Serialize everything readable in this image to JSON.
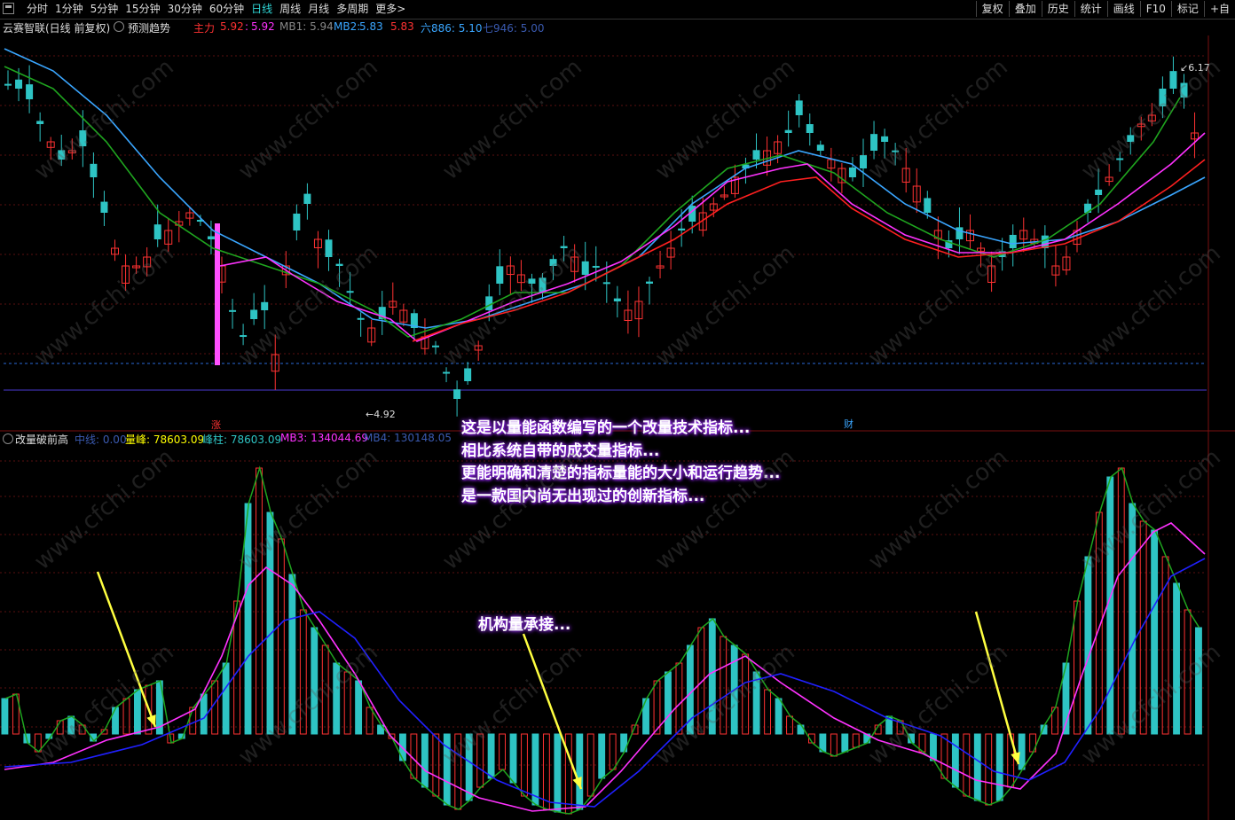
{
  "toolbar": {
    "timeframes": [
      "分时",
      "1分钟",
      "5分钟",
      "15分钟",
      "30分钟",
      "60分钟",
      "日线",
      "周线",
      "月线",
      "多周期",
      "更多>"
    ],
    "active": "日线",
    "right_buttons": [
      "复权",
      "叠加",
      "历史",
      "统计",
      "画线",
      "F10",
      "标记",
      "+自"
    ]
  },
  "main_title": {
    "stock": "云赛智联(日线 前复权)",
    "predict": "预测趋势",
    "zhuli_label": "主力",
    "zhuli_v1": "5.92",
    "zhuli_v2": "5.92",
    "mb1": "MB1: 5.94",
    "mb2_label": "MB2:",
    "mb2_v1": "5.83",
    "mb2_v2": "5.83",
    "liu": "六886: 5.10",
    "qi": "七946: 5.00"
  },
  "price_labels": {
    "high": "6.17",
    "low": "4.92"
  },
  "markers": {
    "zhang": "涨",
    "cai": "财"
  },
  "indicator_title": {
    "name": "改量破前高",
    "zhongxian": "中线: 0.00",
    "liangfeng": "量峰: 78603.09",
    "fengzhu": "峰柱: 78603.09",
    "mb3": "MB3: 134044.69",
    "mb4": "MB4: 130148.05"
  },
  "annotation": [
    "这是以量能函数编写的一个改量技术指标...",
    "相比系统自带的成交量指标...",
    "更能明确和清楚的指标量能的大小和运行趋势...",
    "是一款国内尚无出现过的创新指标..."
  ],
  "annotation2": "机构量承接...",
  "watermark": "www.cfchi.com",
  "colors": {
    "up": "#ff3232",
    "down": "#2ec4c4",
    "ma_green": "#1fa51f",
    "ma_blue": "#3aa6ff",
    "ma_magenta": "#ff32ff",
    "ma_red": "#ff2020"
  }
}
